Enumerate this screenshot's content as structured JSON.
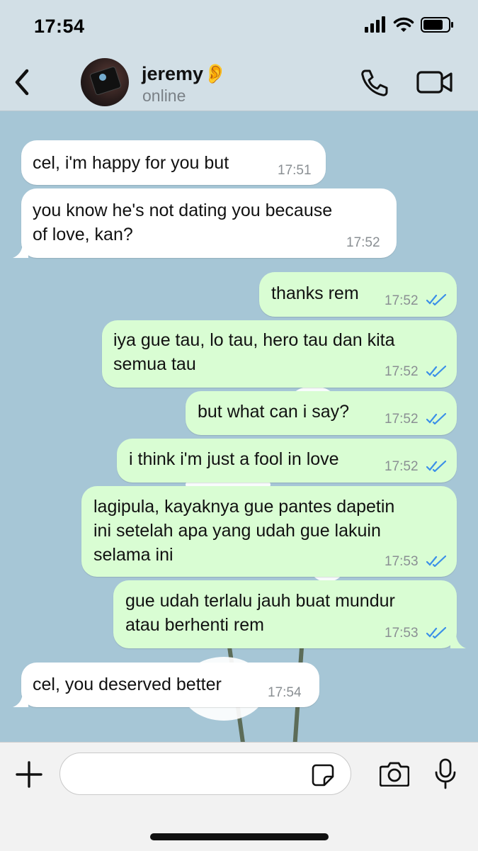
{
  "status_bar": {
    "time": "17:54"
  },
  "header": {
    "contact_name": "jeremy👂",
    "contact_status": "online",
    "icons": [
      "back-chevron-icon",
      "phone-icon",
      "video-camera-icon"
    ]
  },
  "colors": {
    "chat_background": "#a6c6d6",
    "incoming_bubble": "#ffffff",
    "outgoing_bubble": "#d9fdd3",
    "read_ticks": "#3b8fe8"
  },
  "messages": [
    {
      "direction": "incoming",
      "text": "cel, i'm happy for you but",
      "time": "17:51"
    },
    {
      "direction": "incoming",
      "text": "you know he's not dating you because\nof love, kan?",
      "time": "17:52"
    },
    {
      "direction": "outgoing",
      "text": "thanks rem",
      "time": "17:52",
      "status": "read"
    },
    {
      "direction": "outgoing",
      "text": "iya gue tau, lo tau, hero tau dan kita\nsemua tau",
      "time": "17:52",
      "status": "read"
    },
    {
      "direction": "outgoing",
      "text": "but what can i say?",
      "time": "17:52",
      "status": "read"
    },
    {
      "direction": "outgoing",
      "text": "i think i'm just a fool in love",
      "time": "17:52",
      "status": "read"
    },
    {
      "direction": "outgoing",
      "text": "lagipula, kayaknya gue pantes dapetin\nini setelah apa yang udah gue lakuin\nselama ini",
      "time": "17:53",
      "status": "read"
    },
    {
      "direction": "outgoing",
      "text": "gue udah terlalu jauh buat mundur\natau berhenti rem",
      "time": "17:53",
      "status": "read"
    },
    {
      "direction": "incoming",
      "text": "cel, you deserved better",
      "time": "17:54"
    }
  ],
  "input_bar": {
    "placeholder": "",
    "icons": [
      "plus-icon",
      "sticker-icon",
      "camera-icon",
      "microphone-icon"
    ]
  }
}
